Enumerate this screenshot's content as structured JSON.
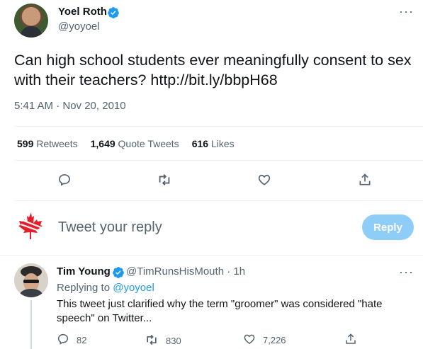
{
  "main_tweet": {
    "author_name": "Yoel Roth",
    "author_handle": "@yoyoel",
    "text": "Can high school students ever meaningfully consent to sex with their teachers? http://bit.ly/bbpH68",
    "timestamp": "5:41 AM · Nov 20, 2010",
    "stats": {
      "retweets_count": "599",
      "retweets_label": "Retweets",
      "quote_tweets_count": "1,649",
      "quote_tweets_label": "Quote Tweets",
      "likes_count": "616",
      "likes_label": "Likes"
    }
  },
  "reply_composer": {
    "placeholder": "Tweet your reply",
    "button_label": "Reply"
  },
  "reply_tweet": {
    "author_name": "Tim Young",
    "author_handle": "@TimRunsHisMouth · 1h",
    "replying_to_prefix": "Replying to ",
    "replying_to_handle": "@yoyoel",
    "text": "This tweet just clarified why the term \"groomer\" was considered \"hate speech\" on Twitter...",
    "reply_count": "82",
    "retweet_count": "830",
    "like_count": "7,226"
  },
  "colors": {
    "verified": "#1d9bf0",
    "reply_button_disabled": "#8ecdf8",
    "secondary_text": "#536471",
    "maple_leaf": "#e0202a"
  },
  "icons": [
    "verified-icon",
    "more-icon",
    "reply-icon",
    "retweet-icon",
    "like-icon",
    "share-icon",
    "maple-leaf-icon"
  ]
}
